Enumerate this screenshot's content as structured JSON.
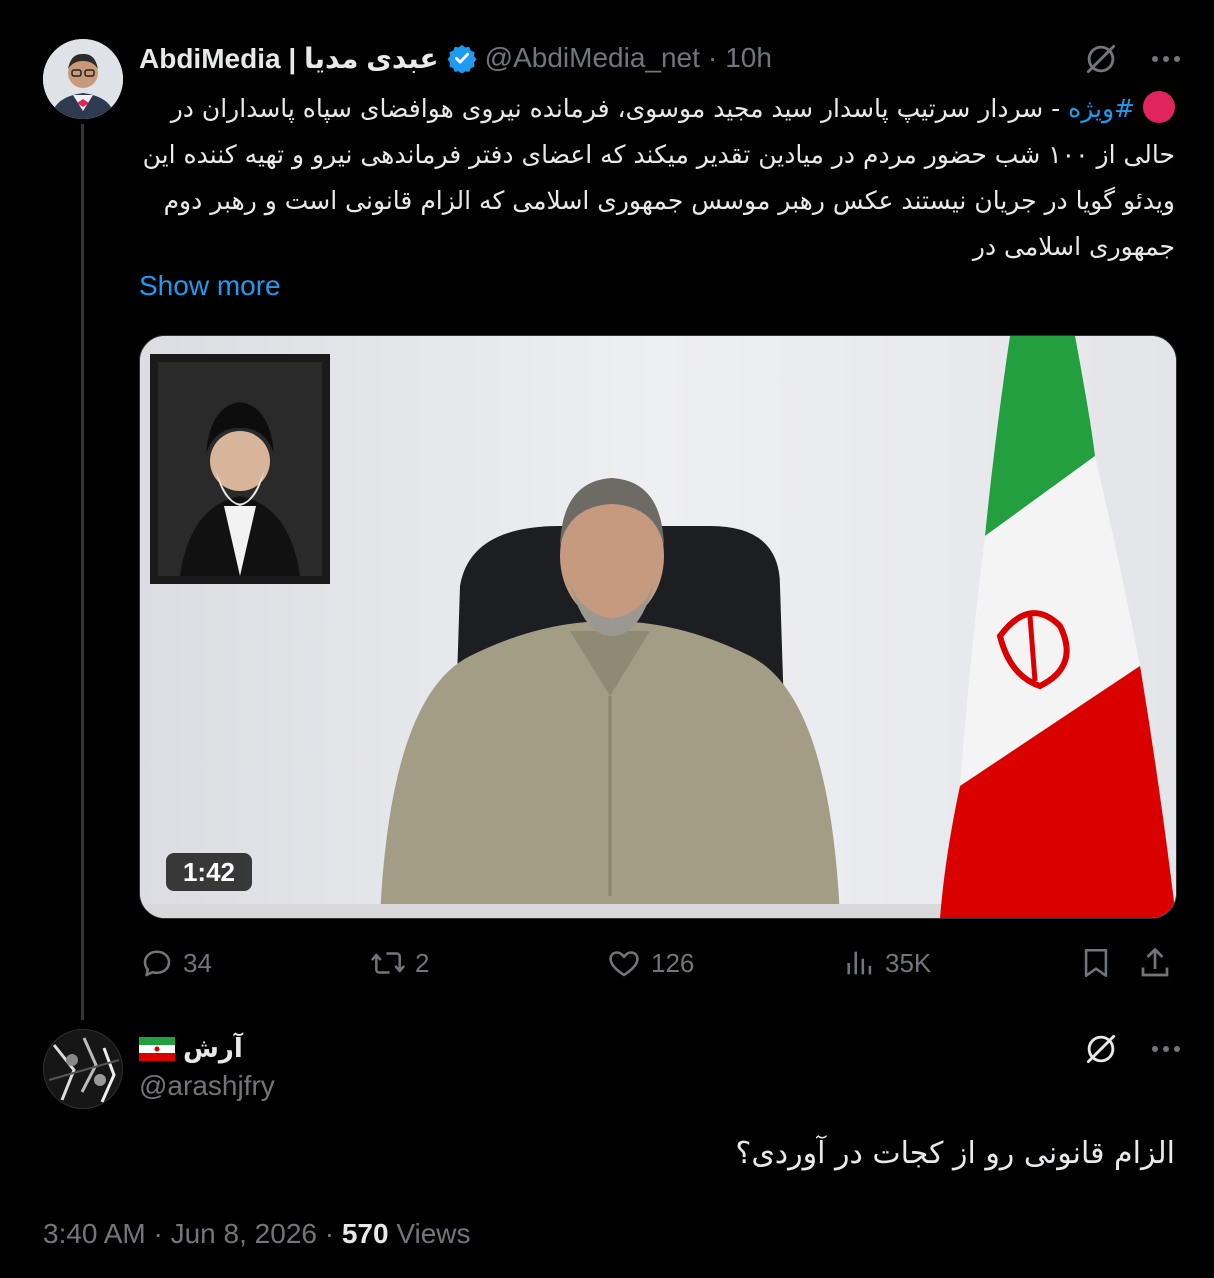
{
  "tweet": {
    "author_name": "AbdiMedia | عبدی مدیا",
    "handle": "@AbdiMedia_net",
    "separator": "·",
    "time_ago": "10h",
    "hashtag": "#ویژه",
    "text_part1": "- سردار سرتیپ پاسدار سید مجید موسوی، فرمانده نیروی هوافضای سپاه پاسداران در حالی از ۱۰۰ شب حضور مردم در میادین تقدیر میکند که اعضای دفتر فرماندهی نیرو و تهیه کننده این ویدئو گویا در جریان نیستند عکس رهبر موسس جمهوری اسلامی که الزام قانونی است و رهبر دوم جمهوری اسلامی در",
    "show_more": "Show more",
    "video_duration": "1:42",
    "stats": {
      "replies": "34",
      "retweets": "2",
      "likes": "126",
      "views": "35K"
    }
  },
  "reply": {
    "author_name": "آرش",
    "handle": "@arashjfry",
    "text": "الزام قانونی رو از کجات در آوردی؟",
    "timestamp": "3:40 AM · Jun 8, 2026 · ",
    "view_count": "570",
    "views_label": " Views"
  },
  "colors": {
    "accent": "#1d9bf0",
    "background": "#000000",
    "muted": "#71767b",
    "text": "#e7e9ea"
  },
  "icons": [
    "grok-icon",
    "more-icon",
    "reply-icon",
    "retweet-icon",
    "like-icon",
    "views-icon",
    "bookmark-icon",
    "share-icon",
    "verified-icon",
    "iran-flag-icon"
  ]
}
